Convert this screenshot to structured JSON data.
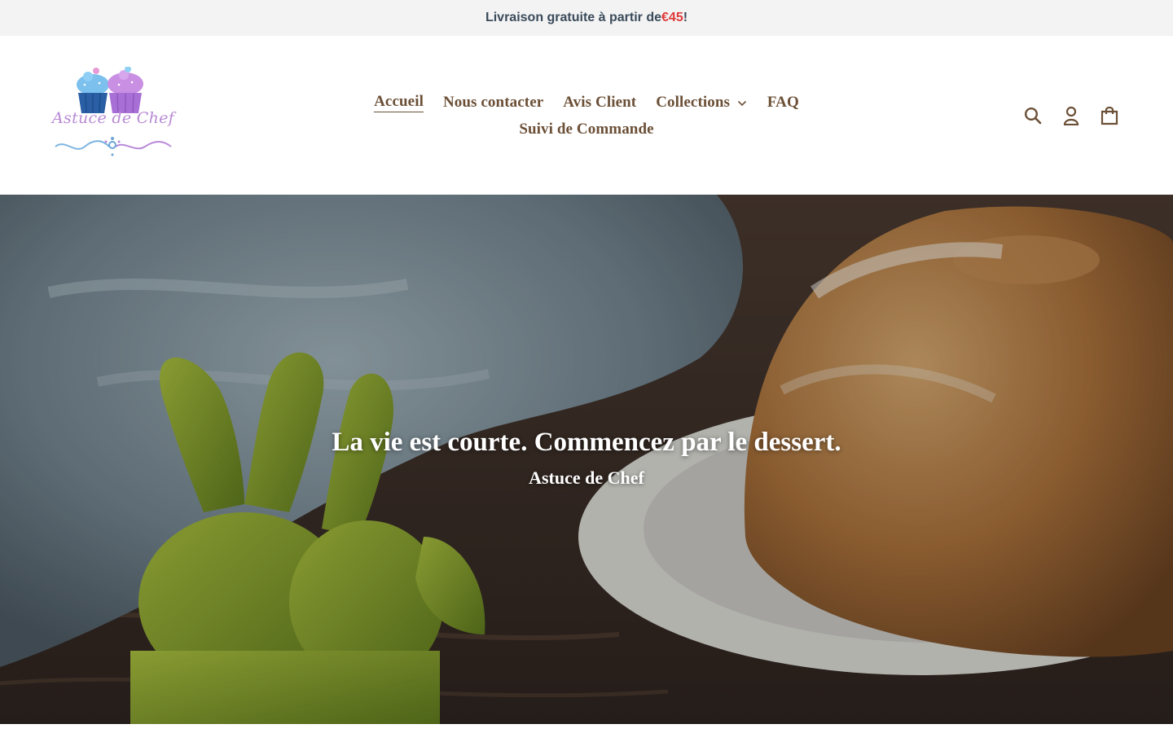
{
  "announcement": {
    "text_before": "Livraison gratuite à partir de ",
    "price": "€45",
    "text_after": "!",
    "price_color": "#e03a3a"
  },
  "logo": {
    "text": "Astuce de Chef",
    "image_name": "cupcakes-logo-icon"
  },
  "nav": {
    "items": [
      {
        "label": "Accueil",
        "active": true
      },
      {
        "label": "Nous contacter"
      },
      {
        "label": "Avis Client"
      },
      {
        "label": "Collections",
        "has_dropdown": true
      },
      {
        "label": "FAQ"
      },
      {
        "label": "Suivi de Commande"
      }
    ]
  },
  "header_icons": [
    {
      "name": "search-icon"
    },
    {
      "name": "account-icon"
    },
    {
      "name": "cart-icon"
    }
  ],
  "hero": {
    "title": "La vie est courte. Commencez par le dessert.",
    "subtitle": "Astuce de Chef",
    "image_name": "bundt-cake-easter-bunnies-image"
  },
  "colors": {
    "nav_text": "#6b4f36",
    "announcement_bg": "#f3f3f3",
    "announcement_text": "#3a4a5a"
  }
}
